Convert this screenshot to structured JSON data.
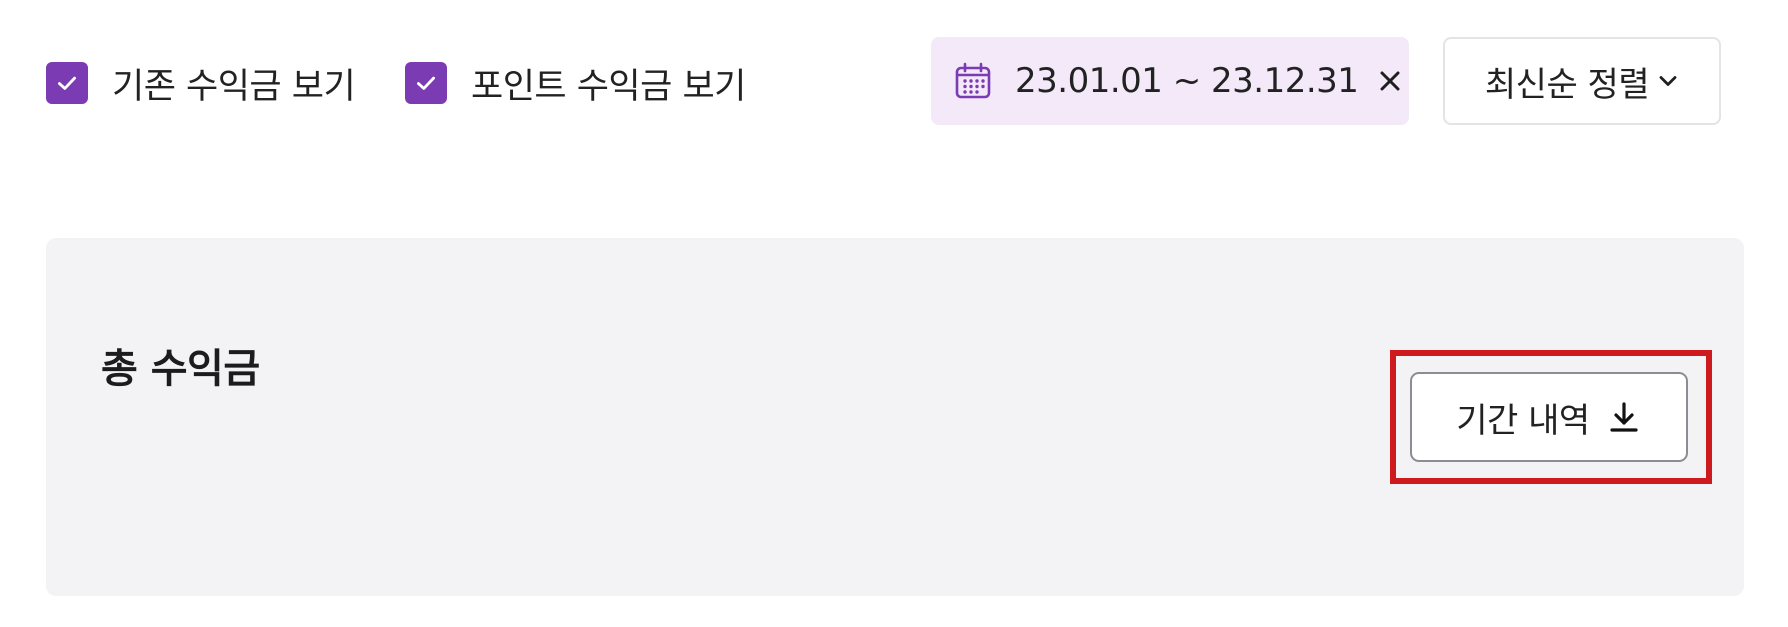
{
  "filters": {
    "show_existing_earnings": {
      "label": "기존 수익금 보기",
      "checked": true
    },
    "show_point_earnings": {
      "label": "포인트 수익금 보기",
      "checked": true
    }
  },
  "date_range": {
    "text": "23.01.01 ~ 23.12.31",
    "icon": "calendar-icon",
    "clear_icon": "close-icon"
  },
  "sort": {
    "label": "최신순 정렬",
    "icon": "chevron-down-icon"
  },
  "summary": {
    "title": "총 수익금",
    "download_button": {
      "label": "기간 내역",
      "icon": "download-icon"
    }
  },
  "colors": {
    "checkbox": "#7b3bb3",
    "date_chip_bg": "#f3e9f8",
    "card_bg": "#f3f3f6",
    "highlight": "#cc1a1f"
  }
}
